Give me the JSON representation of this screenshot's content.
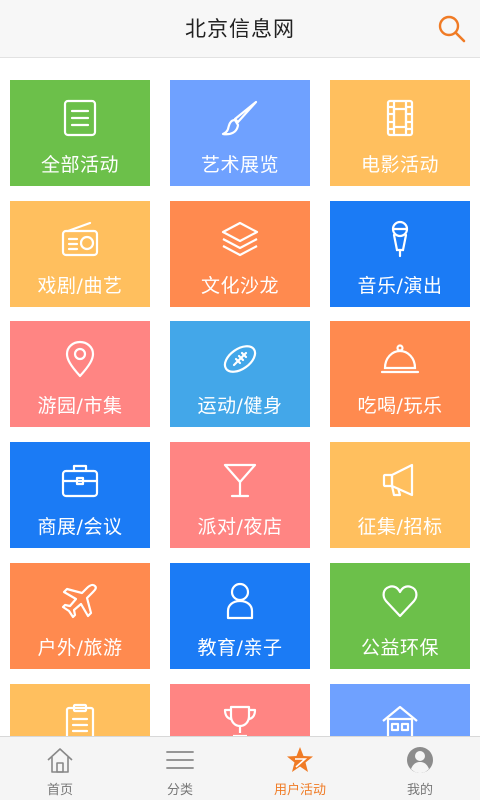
{
  "header": {
    "title": "北京信息网"
  },
  "tiles": [
    {
      "label": "全部活动",
      "color": "#6cc04a",
      "icon": "list-icon"
    },
    {
      "label": "艺术展览",
      "color": "#6fa1ff",
      "icon": "paintbrush-icon"
    },
    {
      "label": "电影活动",
      "color": "#ffbf5e",
      "icon": "film-icon"
    },
    {
      "label": "戏剧/曲艺",
      "color": "#ffbf5e",
      "icon": "radio-icon"
    },
    {
      "label": "文化沙龙",
      "color": "#ff8a4f",
      "icon": "layers-icon"
    },
    {
      "label": "音乐/演出",
      "color": "#1b7bf5",
      "icon": "microphone-icon"
    },
    {
      "label": "游园/市集",
      "color": "#ff8583",
      "icon": "location-pin-icon"
    },
    {
      "label": "运动/健身",
      "color": "#43a7e9",
      "icon": "football-icon"
    },
    {
      "label": "吃喝/玩乐",
      "color": "#ff8a4f",
      "icon": "food-cloche-icon"
    },
    {
      "label": "商展/会议",
      "color": "#1b7bf5",
      "icon": "briefcase-icon"
    },
    {
      "label": "派对/夜店",
      "color": "#ff8583",
      "icon": "cocktail-icon"
    },
    {
      "label": "征集/招标",
      "color": "#ffbf5e",
      "icon": "megaphone-icon"
    },
    {
      "label": "户外/旅游",
      "color": "#ff8a4f",
      "icon": "airplane-icon"
    },
    {
      "label": "教育/亲子",
      "color": "#1b7bf5",
      "icon": "person-icon"
    },
    {
      "label": "公益环保",
      "color": "#6cc04a",
      "icon": "heart-icon"
    },
    {
      "label": "",
      "color": "#ffbf5e",
      "icon": "clipboard-icon"
    },
    {
      "label": "",
      "color": "#ff8583",
      "icon": "trophy-icon"
    },
    {
      "label": "",
      "color": "#6fa1ff",
      "icon": "house-icon"
    }
  ],
  "tabbar": {
    "home": "首页",
    "category": "分类",
    "user_events": "用户活动",
    "mine": "我的",
    "active_color": "#f07b25"
  }
}
